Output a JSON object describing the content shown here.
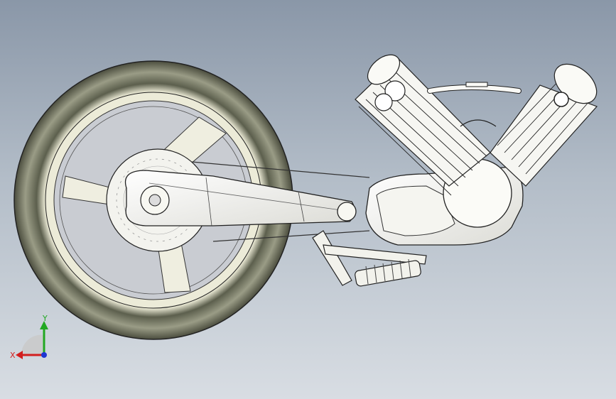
{
  "viewport": {
    "background_top": "#8a97a8",
    "background_bottom": "#d8dde3"
  },
  "model": {
    "description_visible": false,
    "colors": {
      "tire": "#6f725f",
      "rim": "#e9e8d6",
      "engine": "#f4f4f2",
      "outline": "#1a1a1a"
    }
  },
  "triad": {
    "x_label": "X",
    "y_label": "Y",
    "x_color": "#d21e1e",
    "y_color": "#22a822",
    "z_color": "#1e36d2"
  }
}
